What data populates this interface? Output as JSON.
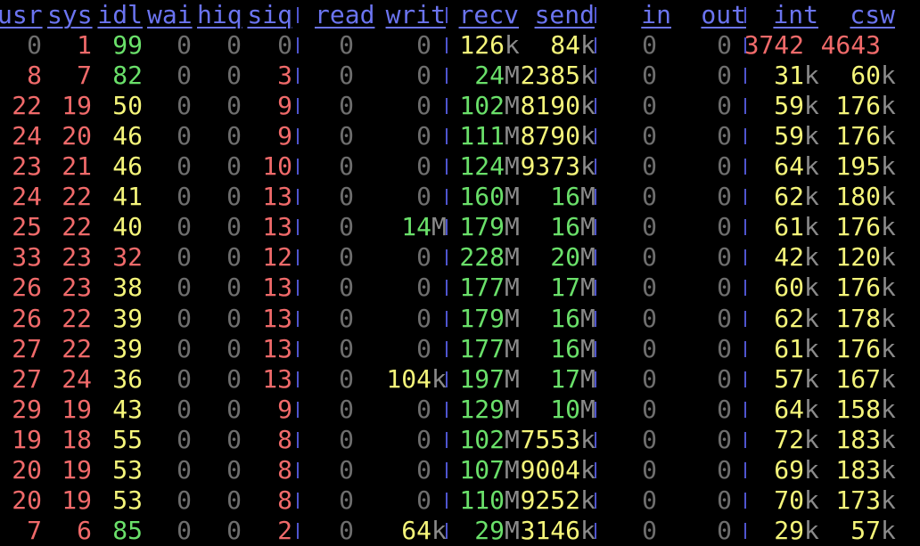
{
  "colors": {
    "background": "#000000",
    "header": "#6b74f0",
    "separator": "#4f55cf",
    "zero": "#6e6e6e",
    "red": "#f06a6a",
    "yellow": "#f5f57a",
    "green": "#6ae06a",
    "unit": "#8a8a8a"
  },
  "headers": [
    "usr",
    "sys",
    "idl",
    "wai",
    "hiq",
    "siq",
    "read",
    "writ",
    "recv",
    "send",
    "in",
    "out",
    "int",
    "csw"
  ],
  "rows": [
    [
      [
        "0",
        "z"
      ],
      [
        "1",
        "r"
      ],
      [
        "99",
        "g"
      ],
      [
        "0",
        "z"
      ],
      [
        "0",
        "z"
      ],
      [
        "0",
        "z"
      ],
      [
        "0",
        "z"
      ],
      [
        "0",
        "z"
      ],
      [
        "126",
        "y",
        "k"
      ],
      [
        "84",
        "y",
        "k"
      ],
      [
        "0",
        "z"
      ],
      [
        "0",
        "z"
      ],
      [
        "3742",
        "r"
      ],
      [
        "4643",
        "r"
      ]
    ],
    [
      [
        "8",
        "r"
      ],
      [
        "7",
        "r"
      ],
      [
        "82",
        "g"
      ],
      [
        "0",
        "z"
      ],
      [
        "0",
        "z"
      ],
      [
        "3",
        "r"
      ],
      [
        "0",
        "z"
      ],
      [
        "0",
        "z"
      ],
      [
        "24",
        "g",
        "M"
      ],
      [
        "2385",
        "y",
        "k"
      ],
      [
        "0",
        "z"
      ],
      [
        "0",
        "z"
      ],
      [
        "31",
        "y",
        "k"
      ],
      [
        "60",
        "y",
        "k"
      ]
    ],
    [
      [
        "22",
        "r"
      ],
      [
        "19",
        "r"
      ],
      [
        "50",
        "y"
      ],
      [
        "0",
        "z"
      ],
      [
        "0",
        "z"
      ],
      [
        "9",
        "r"
      ],
      [
        "0",
        "z"
      ],
      [
        "0",
        "z"
      ],
      [
        "102",
        "g",
        "M"
      ],
      [
        "8190",
        "y",
        "k"
      ],
      [
        "0",
        "z"
      ],
      [
        "0",
        "z"
      ],
      [
        "59",
        "y",
        "k"
      ],
      [
        "176",
        "y",
        "k"
      ]
    ],
    [
      [
        "24",
        "r"
      ],
      [
        "20",
        "r"
      ],
      [
        "46",
        "y"
      ],
      [
        "0",
        "z"
      ],
      [
        "0",
        "z"
      ],
      [
        "9",
        "r"
      ],
      [
        "0",
        "z"
      ],
      [
        "0",
        "z"
      ],
      [
        "111",
        "g",
        "M"
      ],
      [
        "8790",
        "y",
        "k"
      ],
      [
        "0",
        "z"
      ],
      [
        "0",
        "z"
      ],
      [
        "59",
        "y",
        "k"
      ],
      [
        "176",
        "y",
        "k"
      ]
    ],
    [
      [
        "23",
        "r"
      ],
      [
        "21",
        "r"
      ],
      [
        "46",
        "y"
      ],
      [
        "0",
        "z"
      ],
      [
        "0",
        "z"
      ],
      [
        "10",
        "r"
      ],
      [
        "0",
        "z"
      ],
      [
        "0",
        "z"
      ],
      [
        "124",
        "g",
        "M"
      ],
      [
        "9373",
        "y",
        "k"
      ],
      [
        "0",
        "z"
      ],
      [
        "0",
        "z"
      ],
      [
        "64",
        "y",
        "k"
      ],
      [
        "195",
        "y",
        "k"
      ]
    ],
    [
      [
        "24",
        "r"
      ],
      [
        "22",
        "r"
      ],
      [
        "41",
        "y"
      ],
      [
        "0",
        "z"
      ],
      [
        "0",
        "z"
      ],
      [
        "13",
        "r"
      ],
      [
        "0",
        "z"
      ],
      [
        "0",
        "z"
      ],
      [
        "160",
        "g",
        "M"
      ],
      [
        "16",
        "g",
        "M"
      ],
      [
        "0",
        "z"
      ],
      [
        "0",
        "z"
      ],
      [
        "62",
        "y",
        "k"
      ],
      [
        "180",
        "y",
        "k"
      ]
    ],
    [
      [
        "25",
        "r"
      ],
      [
        "22",
        "r"
      ],
      [
        "40",
        "y"
      ],
      [
        "0",
        "z"
      ],
      [
        "0",
        "z"
      ],
      [
        "13",
        "r"
      ],
      [
        "0",
        "z"
      ],
      [
        "14",
        "g",
        "M"
      ],
      [
        "179",
        "g",
        "M"
      ],
      [
        "16",
        "g",
        "M"
      ],
      [
        "0",
        "z"
      ],
      [
        "0",
        "z"
      ],
      [
        "61",
        "y",
        "k"
      ],
      [
        "176",
        "y",
        "k"
      ]
    ],
    [
      [
        "33",
        "r"
      ],
      [
        "23",
        "r"
      ],
      [
        "32",
        "r"
      ],
      [
        "0",
        "z"
      ],
      [
        "0",
        "z"
      ],
      [
        "12",
        "r"
      ],
      [
        "0",
        "z"
      ],
      [
        "0",
        "z"
      ],
      [
        "228",
        "g",
        "M"
      ],
      [
        "20",
        "g",
        "M"
      ],
      [
        "0",
        "z"
      ],
      [
        "0",
        "z"
      ],
      [
        "42",
        "y",
        "k"
      ],
      [
        "120",
        "y",
        "k"
      ]
    ],
    [
      [
        "26",
        "r"
      ],
      [
        "23",
        "r"
      ],
      [
        "38",
        "y"
      ],
      [
        "0",
        "z"
      ],
      [
        "0",
        "z"
      ],
      [
        "13",
        "r"
      ],
      [
        "0",
        "z"
      ],
      [
        "0",
        "z"
      ],
      [
        "177",
        "g",
        "M"
      ],
      [
        "17",
        "g",
        "M"
      ],
      [
        "0",
        "z"
      ],
      [
        "0",
        "z"
      ],
      [
        "60",
        "y",
        "k"
      ],
      [
        "176",
        "y",
        "k"
      ]
    ],
    [
      [
        "26",
        "r"
      ],
      [
        "22",
        "r"
      ],
      [
        "39",
        "y"
      ],
      [
        "0",
        "z"
      ],
      [
        "0",
        "z"
      ],
      [
        "13",
        "r"
      ],
      [
        "0",
        "z"
      ],
      [
        "0",
        "z"
      ],
      [
        "179",
        "g",
        "M"
      ],
      [
        "16",
        "g",
        "M"
      ],
      [
        "0",
        "z"
      ],
      [
        "0",
        "z"
      ],
      [
        "62",
        "y",
        "k"
      ],
      [
        "178",
        "y",
        "k"
      ]
    ],
    [
      [
        "27",
        "r"
      ],
      [
        "22",
        "r"
      ],
      [
        "39",
        "y"
      ],
      [
        "0",
        "z"
      ],
      [
        "0",
        "z"
      ],
      [
        "13",
        "r"
      ],
      [
        "0",
        "z"
      ],
      [
        "0",
        "z"
      ],
      [
        "177",
        "g",
        "M"
      ],
      [
        "16",
        "g",
        "M"
      ],
      [
        "0",
        "z"
      ],
      [
        "0",
        "z"
      ],
      [
        "61",
        "y",
        "k"
      ],
      [
        "176",
        "y",
        "k"
      ]
    ],
    [
      [
        "27",
        "r"
      ],
      [
        "24",
        "r"
      ],
      [
        "36",
        "y"
      ],
      [
        "0",
        "z"
      ],
      [
        "0",
        "z"
      ],
      [
        "13",
        "r"
      ],
      [
        "0",
        "z"
      ],
      [
        "104",
        "y",
        "k"
      ],
      [
        "197",
        "g",
        "M"
      ],
      [
        "17",
        "g",
        "M"
      ],
      [
        "0",
        "z"
      ],
      [
        "0",
        "z"
      ],
      [
        "57",
        "y",
        "k"
      ],
      [
        "167",
        "y",
        "k"
      ]
    ],
    [
      [
        "29",
        "r"
      ],
      [
        "19",
        "r"
      ],
      [
        "43",
        "y"
      ],
      [
        "0",
        "z"
      ],
      [
        "0",
        "z"
      ],
      [
        "9",
        "r"
      ],
      [
        "0",
        "z"
      ],
      [
        "0",
        "z"
      ],
      [
        "129",
        "g",
        "M"
      ],
      [
        "10",
        "g",
        "M"
      ],
      [
        "0",
        "z"
      ],
      [
        "0",
        "z"
      ],
      [
        "64",
        "y",
        "k"
      ],
      [
        "158",
        "y",
        "k"
      ]
    ],
    [
      [
        "19",
        "r"
      ],
      [
        "18",
        "r"
      ],
      [
        "55",
        "y"
      ],
      [
        "0",
        "z"
      ],
      [
        "0",
        "z"
      ],
      [
        "8",
        "r"
      ],
      [
        "0",
        "z"
      ],
      [
        "0",
        "z"
      ],
      [
        "102",
        "g",
        "M"
      ],
      [
        "7553",
        "y",
        "k"
      ],
      [
        "0",
        "z"
      ],
      [
        "0",
        "z"
      ],
      [
        "72",
        "y",
        "k"
      ],
      [
        "183",
        "y",
        "k"
      ]
    ],
    [
      [
        "20",
        "r"
      ],
      [
        "19",
        "r"
      ],
      [
        "53",
        "y"
      ],
      [
        "0",
        "z"
      ],
      [
        "0",
        "z"
      ],
      [
        "8",
        "r"
      ],
      [
        "0",
        "z"
      ],
      [
        "0",
        "z"
      ],
      [
        "107",
        "g",
        "M"
      ],
      [
        "9004",
        "y",
        "k"
      ],
      [
        "0",
        "z"
      ],
      [
        "0",
        "z"
      ],
      [
        "69",
        "y",
        "k"
      ],
      [
        "183",
        "y",
        "k"
      ]
    ],
    [
      [
        "20",
        "r"
      ],
      [
        "19",
        "r"
      ],
      [
        "53",
        "y"
      ],
      [
        "0",
        "z"
      ],
      [
        "0",
        "z"
      ],
      [
        "8",
        "r"
      ],
      [
        "0",
        "z"
      ],
      [
        "0",
        "z"
      ],
      [
        "110",
        "g",
        "M"
      ],
      [
        "9252",
        "y",
        "k"
      ],
      [
        "0",
        "z"
      ],
      [
        "0",
        "z"
      ],
      [
        "70",
        "y",
        "k"
      ],
      [
        "173",
        "y",
        "k"
      ]
    ],
    [
      [
        "7",
        "r"
      ],
      [
        "6",
        "r"
      ],
      [
        "85",
        "g"
      ],
      [
        "0",
        "z"
      ],
      [
        "0",
        "z"
      ],
      [
        "2",
        "r"
      ],
      [
        "0",
        "z"
      ],
      [
        "64",
        "y",
        "k"
      ],
      [
        "29",
        "g",
        "M"
      ],
      [
        "3146",
        "y",
        "k"
      ],
      [
        "0",
        "z"
      ],
      [
        "0",
        "z"
      ],
      [
        "29",
        "y",
        "k"
      ],
      [
        "57",
        "y",
        "k"
      ]
    ]
  ]
}
